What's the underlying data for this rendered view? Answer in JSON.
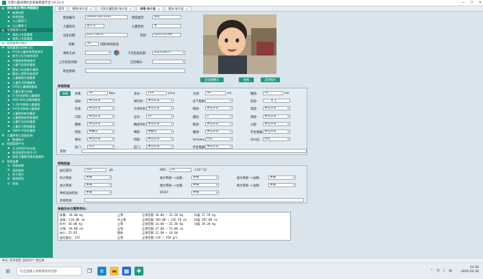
{
  "window": {
    "title": "贝博儿童早期综合发展管理平台 V3.23.0",
    "controls": [
      "—",
      "☐",
      "✕"
    ]
  },
  "sidebar": {
    "items": [
      {
        "label": "体检/复诊/预约/常规随访",
        "icon": "folder-icon",
        "level": 1,
        "state": "hdr"
      },
      {
        "label": "新建档案",
        "icon": "doc-icon",
        "level": 2
      },
      {
        "label": "体检检查",
        "icon": "doc-icon",
        "level": 2
      },
      {
        "label": "儿心量表-1",
        "icon": "doc-icon",
        "level": 2
      },
      {
        "label": "儿心量表-2",
        "icon": "doc-icon",
        "level": 2
      },
      {
        "label": "专案管理与分析",
        "icon": "folder-icon",
        "level": 1,
        "state": "sel"
      },
      {
        "label": "高危儿专案管理",
        "icon": "doc-icon",
        "level": 2
      },
      {
        "label": "营养儿专案管理",
        "icon": "doc-icon",
        "level": 2
      },
      {
        "label": "档案查询与统计",
        "icon": "folder-icon",
        "level": 1,
        "state": "active"
      },
      {
        "label": "常用量表与问卷(14)",
        "icon": "folder-icon",
        "level": 1
      },
      {
        "label": "0-6岁儿童发育筛查测评",
        "icon": "doc-icon",
        "level": 2
      },
      {
        "label": "新生儿行为神经测评",
        "icon": "doc-icon",
        "level": 2
      },
      {
        "label": "丹佛发育筛查测评",
        "icon": "doc-icon",
        "level": 2
      },
      {
        "label": "儿童气质测评量表",
        "icon": "doc-icon",
        "level": 2
      },
      {
        "label": "婴幼儿社会能力量表",
        "icon": "doc-icon",
        "level": 2
      },
      {
        "label": "婴幼儿营养状态测评",
        "icon": "doc-icon",
        "level": 2
      },
      {
        "label": "儿童情绪问卷量表",
        "icon": "doc-icon",
        "level": 2
      },
      {
        "label": "儿童生活质量量表",
        "icon": "doc-icon",
        "level": 2
      },
      {
        "label": "0-6岁儿童睡眠量表",
        "icon": "doc-icon",
        "level": 2
      },
      {
        "label": "儿童注意力问卷",
        "icon": "doc-icon",
        "level": 2
      },
      {
        "label": "0-3岁学龄前儿童量表",
        "icon": "doc-icon",
        "level": 2
      },
      {
        "label": "ASQ-SE社会情绪量表",
        "icon": "doc-icon",
        "level": 2
      },
      {
        "label": "1-3岁学龄前儿童量表",
        "icon": "doc-icon",
        "level": 2
      },
      {
        "label": "3-6岁学龄前儿童量表",
        "icon": "doc-icon",
        "level": 2
      },
      {
        "label": "儿童感觉统合量表",
        "icon": "doc-icon",
        "level": 2
      },
      {
        "label": "儿童孤独症筛查量表",
        "icon": "doc-icon",
        "level": 2
      },
      {
        "label": "儿童行为评估量表",
        "icon": "doc-icon",
        "level": 2
      },
      {
        "label": "儿童学习困难量表",
        "icon": "doc-icon",
        "level": 2
      },
      {
        "label": "SNAP-IV评定量表",
        "icon": "doc-icon",
        "level": 2
      },
      {
        "label": "儿童养育与发展咨询",
        "icon": "folder-icon",
        "level": 1
      },
      {
        "label": "数据统计",
        "icon": "doc-icon",
        "level": 2
      },
      {
        "label": "档案管理平台",
        "icon": "folder-icon",
        "level": 1
      },
      {
        "label": "公卫四项平台对接",
        "icon": "doc-icon",
        "level": 2
      },
      {
        "label": "体检档案共享(0-3)",
        "icon": "doc-icon",
        "level": 2
      },
      {
        "label": "国家卫健委早期发展服务",
        "icon": "doc-icon",
        "level": 2
      },
      {
        "label": "系统设置",
        "icon": "gear-icon",
        "level": 1
      },
      {
        "label": "系统参数",
        "icon": "gear-icon",
        "level": 2
      },
      {
        "label": "组织架构",
        "icon": "gear-icon",
        "level": 2
      },
      {
        "label": "关于我们",
        "icon": "info-icon",
        "level": 2
      },
      {
        "label": "修改密码",
        "icon": "lock-icon",
        "level": 2
      },
      {
        "label": "退出",
        "icon": "exit-icon",
        "level": 2
      }
    ]
  },
  "tabs": [
    {
      "label": "首页",
      "active": false
    },
    {
      "label": "建档-张小宝",
      "active": false
    },
    {
      "label": "打印儿童信息-张小宝",
      "active": false
    },
    {
      "label": "体格-张小宝",
      "active": true
    },
    {
      "label": "报告-张小宝",
      "active": false
    }
  ],
  "patient": {
    "archive_no_label": "档案编号:",
    "archive_no": "0490070011321",
    "archive_type_label": "档案类型:",
    "archive_type": "体检",
    "name_label": "儿童姓名:",
    "name": "张小宝",
    "sex_label": "儿童性别:",
    "sex": "男",
    "dob_label": "出生日期:",
    "dob": "2017-08-07",
    "age_label": "年龄:",
    "age": "4岁07月23天",
    "weeks_label": "系数:",
    "weeks": "56",
    "weeks_unit": "月龄/体检阶段",
    "feeding_label": "喂养方式:",
    "feeding": "",
    "next_date_label": "下次检查日期:",
    "next_date": "2022-08-07",
    "last_date_label": "上次检查日期:",
    "last_date": "",
    "diag_label": "已否确诊:",
    "diag": "",
    "history_label": "既往疾病:",
    "history": ""
  },
  "photo_buttons": [
    "启动摄像头",
    "拍照",
    "选择照片"
  ],
  "physical": {
    "title": "体格检查",
    "tag": "体格",
    "rows": [
      [
        {
          "l": "体重:",
          "v": "36",
          "u": "Kg ▸"
        },
        {
          "l": "身长:",
          "v": "118",
          "u": "cm ▸"
        },
        {
          "l": "头围:",
          "v": "49",
          "u": "cm"
        },
        {
          "l": "胸围:",
          "v": "50",
          "u": "cm"
        }
      ],
      [
        {
          "l": "皮肤:",
          "v": "未见异常"
        },
        {
          "l": "淋巴结:",
          "v": "未见异常"
        },
        {
          "l": "皮下脂肪:",
          "v": ""
        },
        {
          "l": "前囟:",
          "v": "",
          "x": "X"
        }
      ],
      [
        {
          "l": "毛发:",
          "v": "未见异常"
        },
        {
          "l": "头颅外形:",
          "v": "未见异常"
        },
        {
          "l": "眼部:",
          "v": "未见异常"
        },
        {
          "l": "耳部:",
          "v": "未见异常"
        }
      ],
      [
        {
          "l": "口腔:",
          "v": "未见异常"
        },
        {
          "l": "出牙:",
          "v": "20"
        },
        {
          "l": "龋齿:",
          "v": "0"
        },
        {
          "l": "颈部:",
          "v": "未见异常"
        }
      ],
      [
        {
          "l": "胸廓:",
          "v": "未见异常"
        },
        {
          "l": "胸部外形:",
          "v": "未见异常"
        },
        {
          "l": "肺部:",
          "v": "未见异常"
        },
        {
          "l": "心脏:",
          "v": "未见异常"
        }
      ],
      [
        {
          "l": "肝脏:",
          "v": "未触及"
        },
        {
          "l": "脾脏:",
          "v": "未触及"
        },
        {
          "l": "腹部:",
          "v": "未见异常"
        },
        {
          "l": "外生殖器:",
          "v": "未见异常"
        }
      ],
      [
        {
          "l": "脊柱:",
          "v": "未见异常"
        },
        {
          "l": "四肢:",
          "v": "未见异常"
        },
        {
          "l": "Ortolani征:",
          "v": "阴性"
        },
        {
          "l": "Allis征:",
          "v": "阴性"
        }
      ],
      [
        {
          "l": "囟门:",
          "v": "闭合"
        },
        {
          "l": "肛门:",
          "v": "未见异常"
        },
        {
          "l": "外生殖器:",
          "v": "未见异常"
        },
        {
          "l": "",
          "v": ""
        }
      ]
    ],
    "other_label": "其他:",
    "other": "..."
  },
  "special": {
    "title": "特殊检查",
    "hb_label": "血红蛋白:",
    "hb": "122",
    "hb_unit": "g/L",
    "rbc_label": "RBC:",
    "rbc": "22",
    "rbc_unit": "×10^12",
    "rows": [
      [
        {
          "l": "听力筛查:",
          "v": "未做"
        },
        {
          "l": "视力筛查-->左眼:",
          "v": "未做"
        },
        {
          "l": "视力筛查-->右眼:",
          "v": "未做"
        }
      ],
      [
        {
          "l": "视力筛查:",
          "v": "未做"
        },
        {
          "l": "视力筛查-->左眼:",
          "v": "未做"
        },
        {
          "l": "视力筛查-->右眼:",
          "v": "未做"
        }
      ],
      [
        {
          "l": "神经运动检查:",
          "v": "未做"
        },
        {
          "l": "DDST:",
          "v": "未做"
        }
      ]
    ],
    "other_label": "其他检查:",
    "other": ""
  },
  "eval": {
    "title": "体格生长与营养评价:",
    "rows": [
      [
        "体重: 36.00 kg",
        "上等",
        "正常范围 16.00 ~ 23.20 kg",
        "均值 17.70 kg"
      ],
      [
        "身高: 118.00 cm",
        "中上等",
        "正常范围 104.00 ~ 116.70 cm",
        "均值 107.00 cm"
      ],
      [
        "W/H: 36.00 kg",
        "上等",
        "正常范围 14.60 ~ 22.20 kg",
        "均值 18.20 kg"
      ],
      [
        "头围: 49.00 cm",
        "正常",
        "正常范围 47.00 ~ 53.00 cm",
        ""
      ],
      [
        "bmi: 25.85",
        "肥胖",
        "正常范围 12.90 ~ 16.60",
        ""
      ],
      [
        "血红蛋白: 122",
        "正常",
        "正常范围 110 ~ 150 g/L",
        ""
      ]
    ]
  },
  "status": "单位: 医学医院  当前用户: 张红琳",
  "taskbar": {
    "search": "在这里输入你要搜索的内容",
    "time": "21:56",
    "date": "2022-03-30"
  }
}
